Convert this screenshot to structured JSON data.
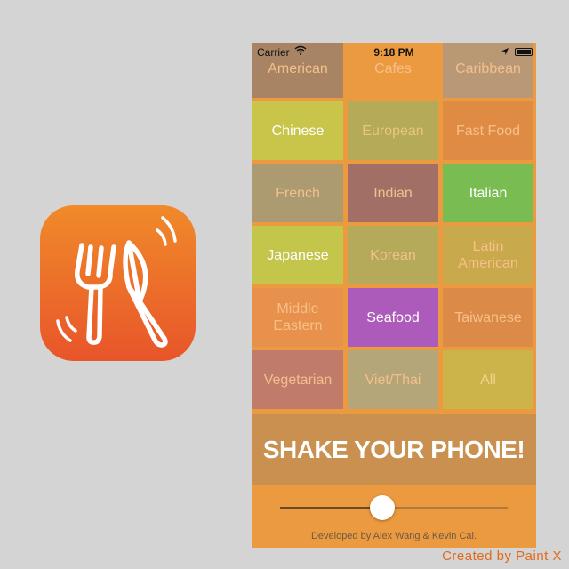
{
  "status_bar": {
    "carrier": "Carrier",
    "time": "9:18 PM"
  },
  "categories": [
    {
      "label": "American",
      "bg": "#a88464",
      "fg": "#f2c08c"
    },
    {
      "label": "Cafes",
      "bg": "#ec9a3f",
      "fg": "#f6c08a"
    },
    {
      "label": "Caribbean",
      "bg": "#b99876",
      "fg": "#f2c08c"
    },
    {
      "label": "Chinese",
      "bg": "#c8c54a",
      "fg": "#ffffff"
    },
    {
      "label": "European",
      "bg": "#b4aa58",
      "fg": "#e9c77a"
    },
    {
      "label": "Fast Food",
      "bg": "#df8b44",
      "fg": "#f6c08a"
    },
    {
      "label": "French",
      "bg": "#ac9a70",
      "fg": "#f2c08c"
    },
    {
      "label": "Indian",
      "bg": "#a16f66",
      "fg": "#f2c08c"
    },
    {
      "label": "Italian",
      "bg": "#79bd52",
      "fg": "#ffffff"
    },
    {
      "label": "Japanese",
      "bg": "#c4c64c",
      "fg": "#ffffff"
    },
    {
      "label": "Korean",
      "bg": "#b4aa5a",
      "fg": "#f2c08c"
    },
    {
      "label": "Latin American",
      "bg": "#c8aa4c",
      "fg": "#f6c08a"
    },
    {
      "label": "Middle Eastern",
      "bg": "#e8914d",
      "fg": "#f6c08a"
    },
    {
      "label": "Seafood",
      "bg": "#ad5bba",
      "fg": "#ffffff"
    },
    {
      "label": "Taiwanese",
      "bg": "#dc8a47",
      "fg": "#f6c08a"
    },
    {
      "label": "Vegetarian",
      "bg": "#c07b6a",
      "fg": "#f2c08c"
    },
    {
      "label": "Viet/Thai",
      "bg": "#b4a678",
      "fg": "#f2c08c"
    },
    {
      "label": "All",
      "bg": "#ccb44a",
      "fg": "#f6d08c"
    }
  ],
  "shake_label": "SHAKE YOUR PHONE!",
  "slider": {
    "value": 0.45
  },
  "credits": "Developed by Alex Wang & Kevin Cai.",
  "watermark": "Created by Paint X",
  "colors": {
    "background": "#d4d4d4",
    "phone_bg": "#ec9a3f",
    "shake_band": "#c99050",
    "icon_gradient_top": "#f08a2a",
    "icon_gradient_bottom": "#e8552a"
  },
  "icons": [
    "fork-knife-icon",
    "wifi-icon",
    "location-arrow-icon",
    "battery-icon"
  ]
}
